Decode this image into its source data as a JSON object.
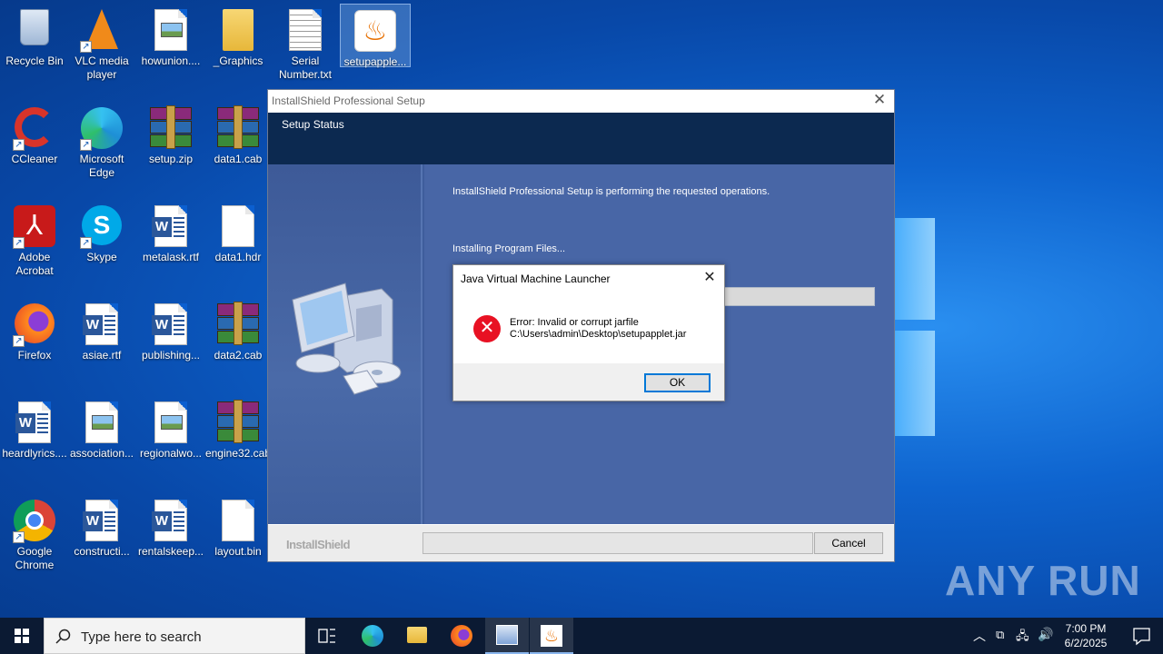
{
  "desktop": {
    "icons": [
      {
        "label": "Recycle Bin"
      },
      {
        "label": "VLC media player"
      },
      {
        "label": "howunion...."
      },
      {
        "label": "_Graphics"
      },
      {
        "label": "Serial Number.txt"
      },
      {
        "label": "setupapple..."
      },
      {
        "label": "CCleaner"
      },
      {
        "label": "Microsoft Edge"
      },
      {
        "label": "setup.zip"
      },
      {
        "label": "data1.cab"
      },
      {
        "label": "Adobe Acrobat"
      },
      {
        "label": "Skype"
      },
      {
        "label": "metalask.rtf"
      },
      {
        "label": "data1.hdr"
      },
      {
        "label": "Firefox"
      },
      {
        "label": "asiae.rtf"
      },
      {
        "label": "publishing..."
      },
      {
        "label": "data2.cab"
      },
      {
        "label": "heardlyrics...."
      },
      {
        "label": "association..."
      },
      {
        "label": "regionalwo..."
      },
      {
        "label": "engine32.cab"
      },
      {
        "label": "Google Chrome"
      },
      {
        "label": "constructi..."
      },
      {
        "label": "rentalskeep..."
      },
      {
        "label": "layout.bin"
      }
    ]
  },
  "installer": {
    "title": "InstallShield Professional Setup",
    "header": "Setup Status",
    "message": "InstallShield Professional Setup is performing the requested operations.",
    "status": "Installing Program Files...",
    "brand": "InstallShield",
    "cancel_label": "Cancel"
  },
  "dialog": {
    "title": "Java Virtual Machine Launcher",
    "error_line1": "Error: Invalid or corrupt jarfile",
    "error_line2": "C:\\Users\\admin\\Desktop\\setupapplet.jar",
    "ok_label": "OK"
  },
  "watermark": "ANY RUN",
  "taskbar": {
    "search_placeholder": "Type here to search",
    "time": "7:00 PM",
    "date": "6/2/2025"
  },
  "colors": {
    "desktop_blue": "#0e64cf",
    "installer_header": "#0c2950",
    "error_red": "#e81123",
    "taskbar": "#0b1a33"
  }
}
